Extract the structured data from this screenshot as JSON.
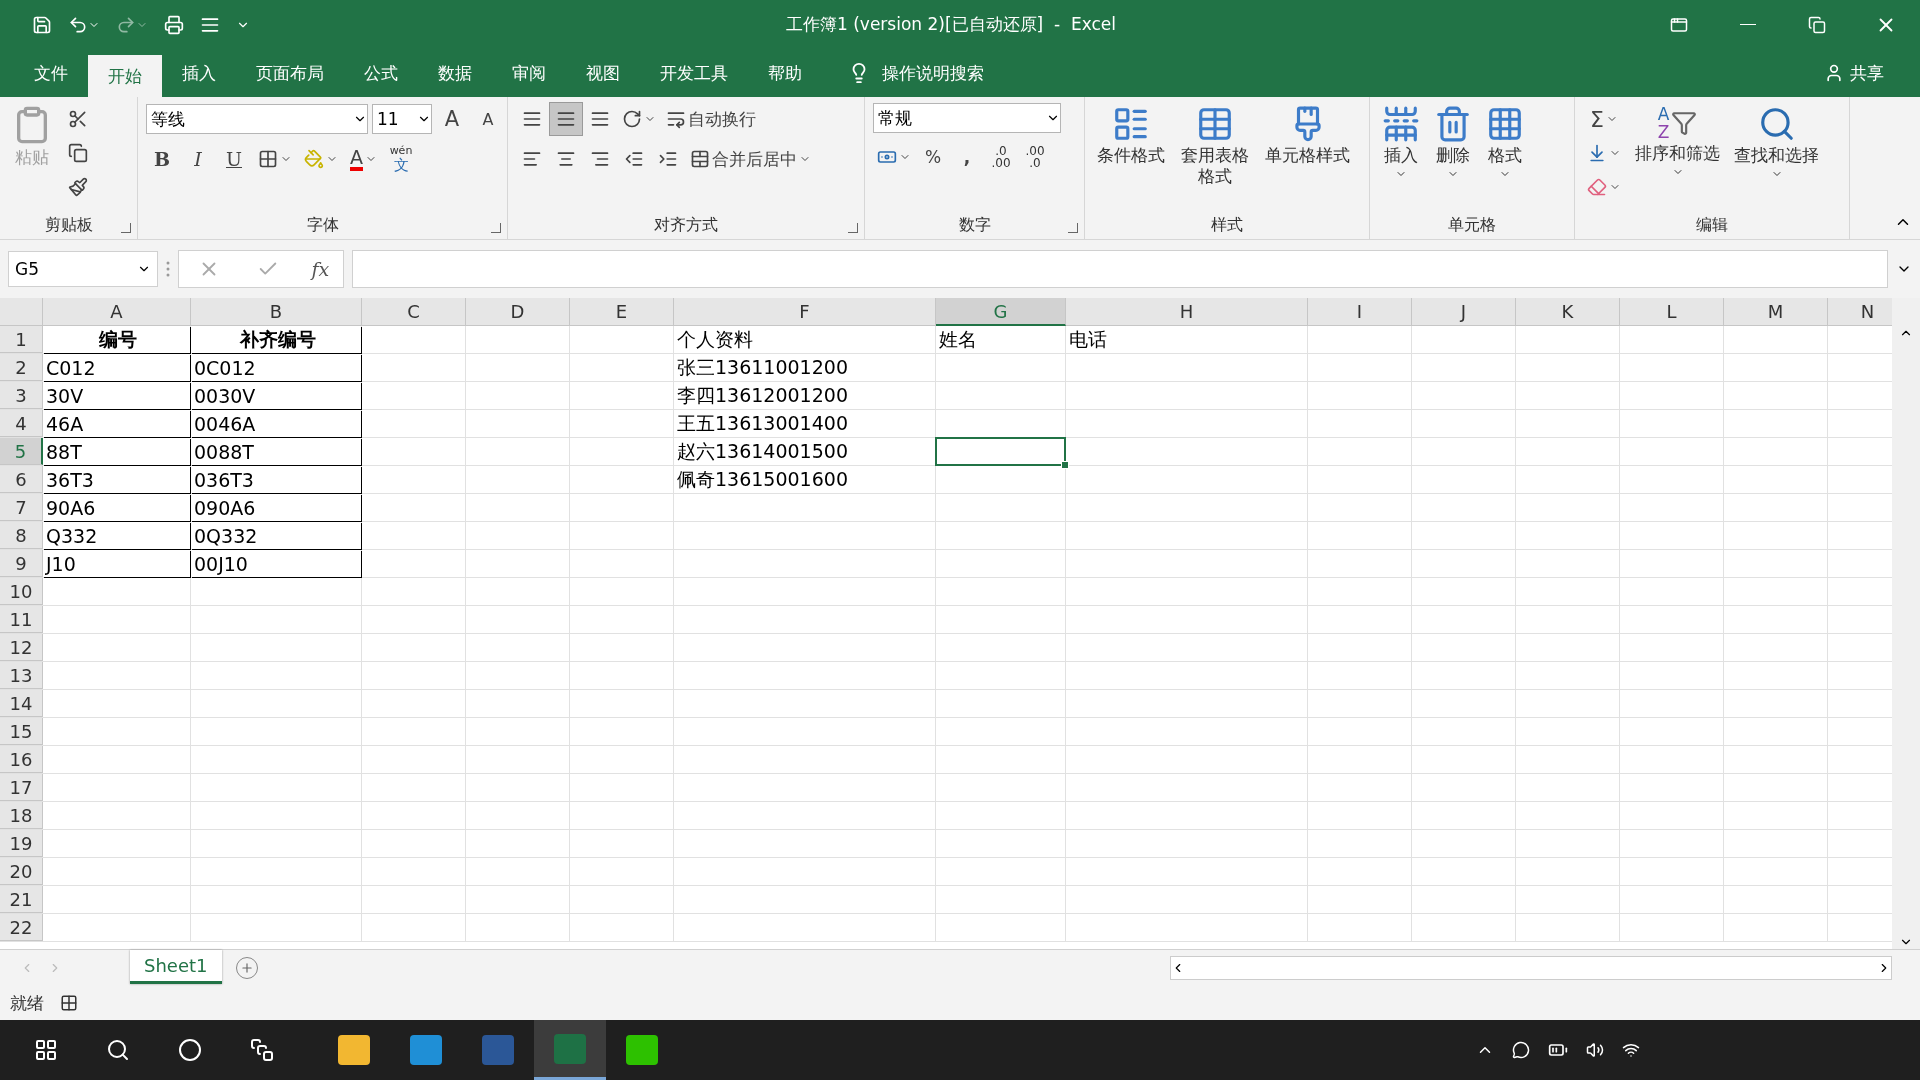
{
  "window": {
    "title": "工作簿1 (version 2)[已自动还原]  -  Excel"
  },
  "menu_tabs": [
    {
      "label": "文件",
      "selected": false
    },
    {
      "label": "开始",
      "selected": true
    },
    {
      "label": "插入",
      "selected": false
    },
    {
      "label": "页面布局",
      "selected": false
    },
    {
      "label": "公式",
      "selected": false
    },
    {
      "label": "数据",
      "selected": false
    },
    {
      "label": "审阅",
      "selected": false
    },
    {
      "label": "视图",
      "selected": false
    },
    {
      "label": "开发工具",
      "selected": false
    },
    {
      "label": "帮助",
      "selected": false
    }
  ],
  "tell_me": {
    "placeholder": "操作说明搜索"
  },
  "share": "共享",
  "ribbon": {
    "clipboard": {
      "label": "剪贴板",
      "paste": "粘贴",
      "paste_disabled": true
    },
    "font": {
      "label": "字体",
      "font_name": "等线",
      "font_size": "11",
      "grow": "A",
      "shrink": "A",
      "format_buttons": [
        {
          "kind": "bold",
          "label": "B"
        },
        {
          "kind": "italic",
          "label": "I"
        },
        {
          "kind": "underline",
          "label": "U"
        }
      ],
      "font_color_letter": "A",
      "phonetic_top": "wén",
      "phonetic_bottom": "文"
    },
    "alignment": {
      "label": "对齐方式",
      "wrap": "自动换行",
      "merge": "合并后居中",
      "middle_selected": true
    },
    "number": {
      "label": "数字",
      "format": "常规",
      "percent": "%",
      "comma": ",",
      "increase_top": ".0",
      "increase_bottom": ".00",
      "decrease_top": ".00",
      "decrease_bottom": ".0"
    },
    "styles": {
      "label": "样式",
      "buttons": [
        {
          "kind": "conditional",
          "label": "条件格式"
        },
        {
          "kind": "table",
          "label": "套用表格格式"
        },
        {
          "kind": "cell",
          "label": "单元格样式"
        }
      ]
    },
    "cells": {
      "label": "单元格",
      "buttons": [
        {
          "kind": "insert",
          "label": "插入"
        },
        {
          "kind": "delete",
          "label": "删除"
        },
        {
          "kind": "format",
          "label": "格式"
        }
      ]
    },
    "editing": {
      "label": "编辑",
      "sum": "Σ",
      "sort": "排序和筛选",
      "sort_letters": [
        "A",
        "Z"
      ],
      "find": "查找和选择"
    }
  },
  "formula_bar": {
    "name_box": "G5",
    "function_label": "fx"
  },
  "columns": [
    {
      "label": "A",
      "selected": false
    },
    {
      "label": "B",
      "selected": false
    },
    {
      "label": "C",
      "selected": false
    },
    {
      "label": "D",
      "selected": false
    },
    {
      "label": "E",
      "selected": false
    },
    {
      "label": "F",
      "selected": false
    },
    {
      "label": "G",
      "selected": true
    },
    {
      "label": "H",
      "selected": false
    },
    {
      "label": "I",
      "selected": false
    },
    {
      "label": "J",
      "selected": false
    },
    {
      "label": "K",
      "selected": false
    },
    {
      "label": "L",
      "selected": false
    },
    {
      "label": "M",
      "selected": false
    },
    {
      "label": "N",
      "selected": false
    }
  ],
  "rows": [
    {
      "label": "1",
      "selected": false,
      "cells": [
        {
          "text": "编号",
          "bold": true,
          "bordered": true
        },
        {
          "text": "补齐编号",
          "bold": true,
          "bordered": true
        },
        {},
        {},
        {},
        {
          "text": "个人资料"
        },
        {
          "text": "姓名"
        },
        {
          "text": "电话"
        }
      ]
    },
    {
      "label": "2",
      "selected": false,
      "cells": [
        {
          "text": "C012",
          "bordered": true
        },
        {
          "text": "0C012",
          "bordered": true
        },
        {},
        {},
        {},
        {
          "text": "张三13611001200"
        }
      ]
    },
    {
      "label": "3",
      "selected": false,
      "cells": [
        {
          "text": "30V",
          "bordered": true
        },
        {
          "text": "0030V",
          "bordered": true
        },
        {},
        {},
        {},
        {
          "text": "李四13612001200"
        }
      ]
    },
    {
      "label": "4",
      "selected": false,
      "cells": [
        {
          "text": "46A",
          "bordered": true
        },
        {
          "text": "0046A",
          "bordered": true
        },
        {},
        {},
        {},
        {
          "text": "王五13613001400"
        }
      ]
    },
    {
      "label": "5",
      "selected": true,
      "cells": [
        {
          "text": "88T",
          "bordered": true
        },
        {
          "text": "0088T",
          "bordered": true
        },
        {},
        {},
        {},
        {
          "text": "赵六13614001500"
        },
        {
          "active": true
        }
      ]
    },
    {
      "label": "6",
      "selected": false,
      "cells": [
        {
          "text": "36T3",
          "bordered": true
        },
        {
          "text": "036T3",
          "bordered": true
        },
        {},
        {},
        {},
        {
          "text": "佩奇13615001600"
        }
      ]
    },
    {
      "label": "7",
      "selected": false,
      "cells": [
        {
          "text": "90A6",
          "bordered": true
        },
        {
          "text": "090A6",
          "bordered": true
        }
      ]
    },
    {
      "label": "8",
      "selected": false,
      "cells": [
        {
          "text": "Q332",
          "bordered": true
        },
        {
          "text": "0Q332",
          "bordered": true
        }
      ]
    },
    {
      "label": "9",
      "selected": false,
      "cells": [
        {
          "text": "J10",
          "bordered": true
        },
        {
          "text": "00J10",
          "bordered": true
        }
      ]
    },
    {
      "label": "10",
      "selected": false
    },
    {
      "label": "11",
      "selected": false
    },
    {
      "label": "12",
      "selected": false
    },
    {
      "label": "13",
      "selected": false
    },
    {
      "label": "14",
      "selected": false
    },
    {
      "label": "15",
      "selected": false
    },
    {
      "label": "16",
      "selected": false
    },
    {
      "label": "17",
      "selected": false
    },
    {
      "label": "18",
      "selected": false
    },
    {
      "label": "19",
      "selected": false
    },
    {
      "label": "20",
      "selected": false
    },
    {
      "label": "21",
      "selected": false
    },
    {
      "label": "22",
      "selected": false
    }
  ],
  "sheet_tabs": [
    {
      "label": "Sheet1",
      "selected": true
    }
  ],
  "status_bar": {
    "text": "就绪"
  },
  "taskbar": {
    "apps": [
      {
        "kind": "explorer",
        "selected": false
      },
      {
        "kind": "edge",
        "selected": false
      },
      {
        "kind": "word",
        "selected": false
      },
      {
        "kind": "excel",
        "selected": true
      },
      {
        "kind": "wechat",
        "selected": false
      }
    ]
  }
}
